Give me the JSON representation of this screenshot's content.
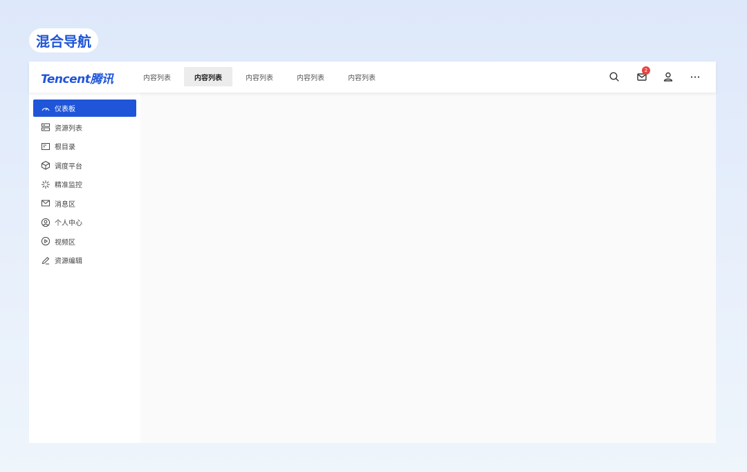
{
  "page_label": "混合导航",
  "header": {
    "logo": "Tencent腾讯",
    "tabs": [
      {
        "label": "内容列表",
        "active": false
      },
      {
        "label": "内容列表",
        "active": true
      },
      {
        "label": "内容列表",
        "active": false
      },
      {
        "label": "内容列表",
        "active": false
      },
      {
        "label": "内容列表",
        "active": false
      }
    ],
    "message_count": "2"
  },
  "sidebar": {
    "items": [
      {
        "label": "仪表板",
        "icon": "dashboard-icon",
        "active": true
      },
      {
        "label": "资源列表",
        "icon": "server-icon",
        "active": false
      },
      {
        "label": "根目录",
        "icon": "folder-icon",
        "active": false
      },
      {
        "label": "调度平台",
        "icon": "cube-icon",
        "active": false
      },
      {
        "label": "精准监控",
        "icon": "loading-icon",
        "active": false
      },
      {
        "label": "消息区",
        "icon": "mail-icon",
        "active": false
      },
      {
        "label": "个人中心",
        "icon": "user-circle-icon",
        "active": false
      },
      {
        "label": "视频区",
        "icon": "play-circle-icon",
        "active": false
      },
      {
        "label": "资源编辑",
        "icon": "edit-icon",
        "active": false
      }
    ]
  },
  "colors": {
    "accent": "#1f55d8",
    "badge": "#e54545",
    "content_bg": "#fafafa"
  }
}
